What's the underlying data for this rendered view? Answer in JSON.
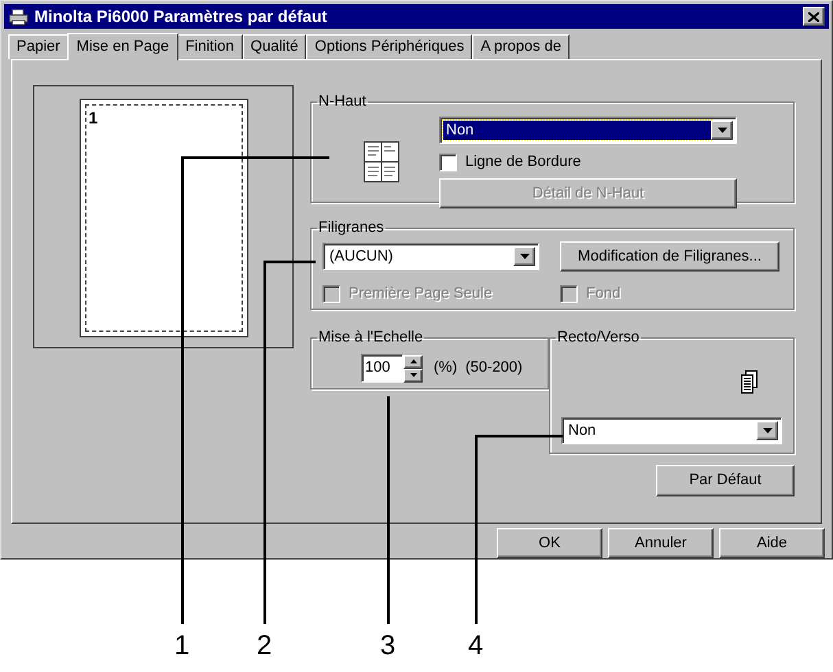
{
  "window": {
    "title": "Minolta Pi6000 Paramètres par défaut"
  },
  "tabs": [
    {
      "label": "Papier",
      "selected": false
    },
    {
      "label": "Mise en Page",
      "selected": true
    },
    {
      "label": "Finition",
      "selected": false
    },
    {
      "label": "Qualité",
      "selected": false
    },
    {
      "label": "Options Périphériques",
      "selected": false
    },
    {
      "label": "A propos de",
      "selected": false
    }
  ],
  "preview": {
    "page_number": "1"
  },
  "n_up": {
    "label": "N-Haut",
    "dropdown": {
      "value": "Non",
      "focused": true
    },
    "border_line": {
      "label": "Ligne de Bordure",
      "checked": false,
      "disabled": false
    },
    "detail_button": {
      "label": "Détail de N-Haut",
      "disabled": true
    }
  },
  "watermarks": {
    "label": "Filigranes",
    "dropdown": {
      "value": "(AUCUN)",
      "focused": false
    },
    "edit_button": {
      "label": "Modification de Filigranes...",
      "disabled": false
    },
    "options": [
      {
        "label": "Première Page Seule",
        "checked": false,
        "disabled": true
      },
      {
        "label": "Fond",
        "checked": false,
        "disabled": true
      }
    ]
  },
  "scaling": {
    "label": "Mise à l'Echelle",
    "value": "100",
    "unit": "(%)",
    "range": "(50-200)"
  },
  "duplex": {
    "label": "Recto/Verso",
    "dropdown": {
      "value": "Non",
      "focused": false
    }
  },
  "default_button": "Par Défaut",
  "buttons": [
    "OK",
    "Annuler",
    "Aide"
  ],
  "callouts": [
    "1",
    "2",
    "3",
    "4"
  ]
}
